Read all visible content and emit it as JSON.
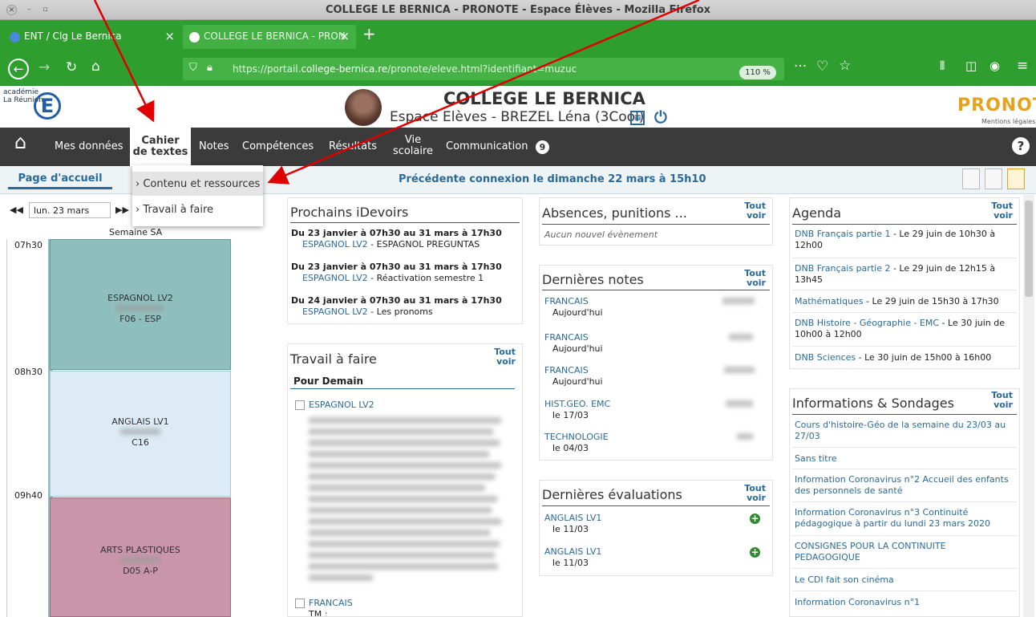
{
  "window": {
    "title": "COLLEGE LE BERNICA - PRONOTE - Espace Élèves - Mozilla Firefox"
  },
  "tabs": [
    {
      "label": "ENT / Clg Le Bernica"
    },
    {
      "label": "COLLEGE LE BERNICA - PRON"
    }
  ],
  "url": {
    "prefix": "https://portail.",
    "domain": "college-bernica.re",
    "path": "/pronote/eleve.html?identifiant=muzuc"
  },
  "zoom": "110 %",
  "header": {
    "logo_line1": "académie",
    "logo_line2": "La Réunion",
    "school": "COLLEGE LE BERNICA",
    "espace": "Espace Elèves - BREZEL Léna (3Cool)",
    "pronote": "PRONOTE",
    "mentions": "Mentions légales"
  },
  "menu": {
    "mes_donnees": "Mes données",
    "cahier_1": "Cahier",
    "cahier_2": "de textes",
    "notes": "Notes",
    "competences": "Compétences",
    "resultats": "Résultats",
    "vie_1": "Vie",
    "vie_2": "scolaire",
    "communication": "Communication",
    "comm_badge": "9"
  },
  "subbar": {
    "home": "Page d'accueil",
    "prev": "Précédente connexion le dimanche 22 mars à 15h10"
  },
  "dropdown": {
    "items": [
      "Contenu et ressources",
      "Travail à faire"
    ]
  },
  "planning": {
    "date": "lun. 23 mars",
    "week": "Semaine SA",
    "times": [
      "07h30",
      "08h30",
      "09h40"
    ],
    "slots": [
      {
        "subject": "ESPAGNOL LV2",
        "room": "F06 - ESP"
      },
      {
        "subject": "ANGLAIS LV1",
        "room": "C16"
      },
      {
        "subject": "ARTS PLASTIQUES",
        "room": "D05 A-P"
      }
    ]
  },
  "idevoirs": {
    "title": "Prochains iDevoirs",
    "items": [
      {
        "when": "Du 23 janvier à 07h30 au 31 mars à 17h30",
        "subject": "ESPAGNOL LV2",
        "desc": " - ESPAGNOL PREGUNTAS"
      },
      {
        "when": "Du 23 janvier à 07h30 au 31 mars à 17h30",
        "subject": "ESPAGNOL LV2",
        "desc": " - Réactivation semestre 1"
      },
      {
        "when": "Du 24 janvier à 07h30 au 31 mars à 17h30",
        "subject": "ESPAGNOL LV2",
        "desc": " - Les pronoms"
      }
    ]
  },
  "travail": {
    "title": "Travail à faire",
    "section": "Pour Demain",
    "items": [
      {
        "subject": "ESPAGNOL LV2"
      },
      {
        "subject": "FRANCAIS",
        "extra": "TM :"
      }
    ]
  },
  "tout": "Tout",
  "voir": "voir",
  "absences": {
    "title": "Absences, punitions ...",
    "empty": "Aucun nouvel évènement"
  },
  "notes": {
    "title": "Dernières notes",
    "items": [
      {
        "subject": "FRANCAIS",
        "date": "Aujourd'hui"
      },
      {
        "subject": "FRANCAIS",
        "date": "Aujourd'hui"
      },
      {
        "subject": "FRANCAIS",
        "date": "Aujourd'hui"
      },
      {
        "subject": "HIST.GEO. EMC",
        "date": "le 17/03"
      },
      {
        "subject": "TECHNOLOGIE",
        "date": "le 04/03"
      }
    ]
  },
  "evaluations": {
    "title": "Dernières évaluations",
    "items": [
      {
        "subject": "ANGLAIS LV1",
        "date": "le 11/03"
      },
      {
        "subject": "ANGLAIS LV1",
        "date": "le 11/03"
      }
    ]
  },
  "agenda": {
    "title": "Agenda",
    "items": [
      {
        "link": "DNB Français partie 1",
        "rest": " - Le 29 juin de 10h30 à 12h00"
      },
      {
        "link": "DNB Français partie 2",
        "rest": " - Le 29 juin de 12h15 à 13h45"
      },
      {
        "link": "Mathématiques",
        "rest": " - Le 29 juin de 15h30 à 17h30"
      },
      {
        "link": "DNB Histoire - Géographie - EMC",
        "rest": " - Le 30 juin de 10h00 à 12h00"
      },
      {
        "link": "DNB Sciences",
        "rest": " - Le 30 juin de 15h00 à 16h00"
      }
    ]
  },
  "infos": {
    "title": "Informations & Sondages",
    "items": [
      "Cours d'histoire-Géo de la semaine du 23/03 au 27/03",
      "Sans titre",
      "Information Coronavirus n°2 Accueil des enfants des personnels de santé",
      "Information Coronavirus n°3 Continuité pédagogique à partir du lundi 23 mars 2020",
      "CONSIGNES POUR LA CONTINUITE PEDAGOGIQUE",
      "Le CDI fait son cinéma",
      "Information Coronavirus n°1"
    ]
  },
  "colors": {
    "firefox_green": "#2e9e2e",
    "menu_dark": "#3b3b3b",
    "link_blue": "#2a6a9a",
    "pronote_orange": "#e6a21a",
    "annotation_red": "#e00000"
  }
}
